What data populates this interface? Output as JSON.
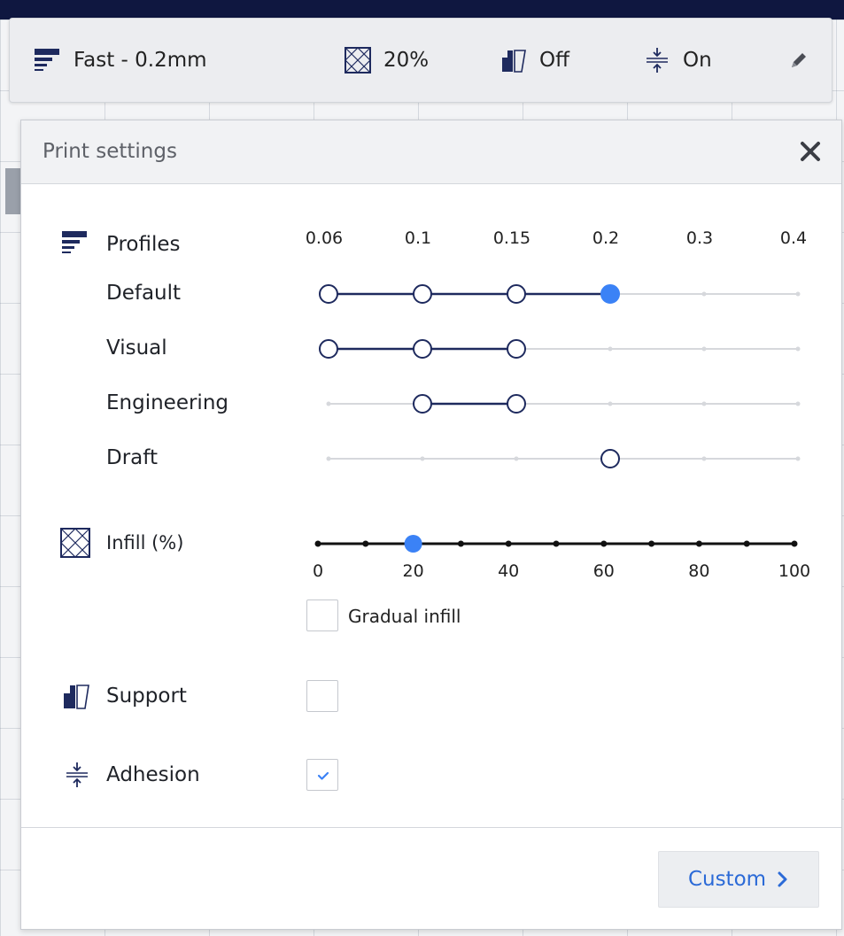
{
  "topbar": {
    "profile": {
      "icon": "profile-lines-icon",
      "label": "Fast - 0.2mm"
    },
    "infill": {
      "icon": "infill-icon",
      "label": "20%"
    },
    "support": {
      "icon": "support-icon",
      "label": "Off"
    },
    "adhesion": {
      "icon": "adhesion-icon",
      "label": "On"
    },
    "edit_icon": "pencil-icon"
  },
  "panel": {
    "title": "Print settings",
    "close_icon": "close-icon",
    "profiles": {
      "label": "Profiles",
      "icon": "profile-lines-icon",
      "layer_heights": [
        "0.06",
        "0.1",
        "0.15",
        "0.2",
        "0.3",
        "0.4"
      ],
      "rows": [
        {
          "name": "Default",
          "available": [
            "0.06",
            "0.1",
            "0.15",
            "0.2"
          ],
          "selected": "0.2"
        },
        {
          "name": "Visual",
          "available": [
            "0.06",
            "0.1",
            "0.15"
          ],
          "selected": null
        },
        {
          "name": "Engineering",
          "available": [
            "0.1",
            "0.15"
          ],
          "selected": null
        },
        {
          "name": "Draft",
          "available": [
            "0.2"
          ],
          "selected": null
        }
      ]
    },
    "infill": {
      "label": "Infill (%)",
      "icon": "infill-icon",
      "value": 20,
      "min": 0,
      "max": 100,
      "tick_labels": [
        "0",
        "20",
        "40",
        "60",
        "80",
        "100"
      ],
      "gradual_infill_label": "Gradual infill",
      "gradual_infill_checked": false
    },
    "support": {
      "label": "Support",
      "icon": "support-icon",
      "checked": false
    },
    "adhesion": {
      "label": "Adhesion",
      "icon": "adhesion-icon",
      "checked": true
    },
    "custom_button": {
      "label": "Custom",
      "icon": "chevron-right-icon"
    }
  },
  "colors": {
    "accent": "#3b82f6",
    "track_active": "#1e2a5e",
    "track_inactive": "#d6d8dc",
    "link": "#2b6ad7"
  }
}
